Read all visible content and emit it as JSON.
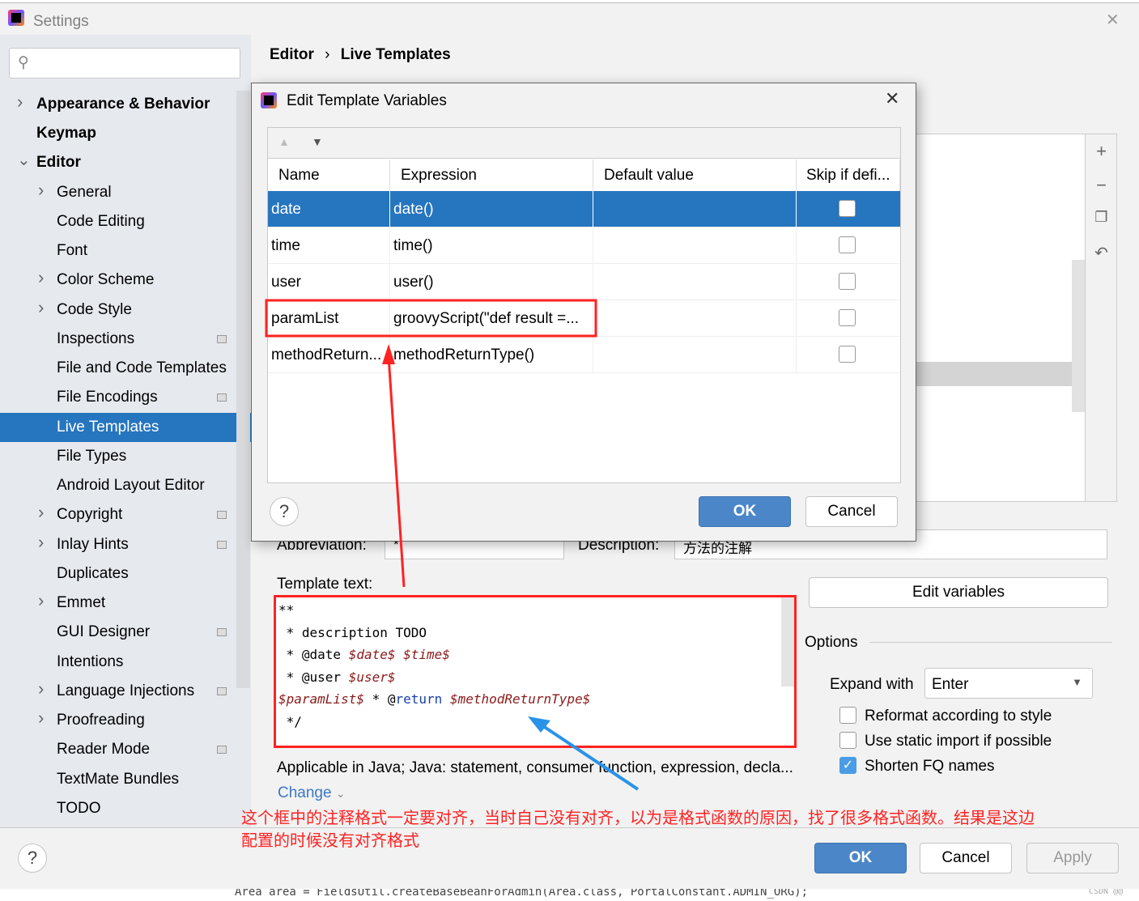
{
  "window": {
    "title": "Settings",
    "close_icon": "close-icon"
  },
  "search": {
    "placeholder": ""
  },
  "sidebar": {
    "items": [
      {
        "label": "Appearance & Behavior",
        "level": 0,
        "bold": true,
        "chevron": "right"
      },
      {
        "label": "Keymap",
        "level": 0,
        "bold": true
      },
      {
        "label": "Editor",
        "level": 0,
        "bold": true,
        "chevron": "down"
      },
      {
        "label": "General",
        "level": 1,
        "chevron": "right"
      },
      {
        "label": "Code Editing",
        "level": 1
      },
      {
        "label": "Font",
        "level": 1
      },
      {
        "label": "Color Scheme",
        "level": 1,
        "chevron": "right"
      },
      {
        "label": "Code Style",
        "level": 1,
        "chevron": "right"
      },
      {
        "label": "Inspections",
        "level": 1,
        "project_icon": true
      },
      {
        "label": "File and Code Templates",
        "level": 1
      },
      {
        "label": "File Encodings",
        "level": 1,
        "project_icon": true
      },
      {
        "label": "Live Templates",
        "level": 1,
        "selected": true
      },
      {
        "label": "File Types",
        "level": 1
      },
      {
        "label": "Android Layout Editor",
        "level": 1
      },
      {
        "label": "Copyright",
        "level": 1,
        "chevron": "right",
        "project_icon": true
      },
      {
        "label": "Inlay Hints",
        "level": 1,
        "chevron": "right",
        "project_icon": true
      },
      {
        "label": "Duplicates",
        "level": 1
      },
      {
        "label": "Emmet",
        "level": 1,
        "chevron": "right"
      },
      {
        "label": "GUI Designer",
        "level": 1,
        "project_icon": true
      },
      {
        "label": "Intentions",
        "level": 1
      },
      {
        "label": "Language Injections",
        "level": 1,
        "chevron": "right",
        "project_icon": true
      },
      {
        "label": "Proofreading",
        "level": 1,
        "chevron": "right"
      },
      {
        "label": "Reader Mode",
        "level": 1,
        "project_icon": true
      },
      {
        "label": "TextMate Bundles",
        "level": 1
      },
      {
        "label": "TODO",
        "level": 1
      }
    ]
  },
  "breadcrumb": {
    "parent": "Editor",
    "separator": "›",
    "current": "Live Templates"
  },
  "form": {
    "abbreviation_label": "Abbreviation:",
    "abbreviation_value": "*",
    "description_label": "Description:",
    "description_value": "方法的注解",
    "template_text_label": "Template text:",
    "template_lines": [
      [
        {
          "t": "**",
          "c": "p"
        }
      ],
      [
        {
          "t": " * description TODO",
          "c": "p"
        }
      ],
      [
        {
          "t": " * @date ",
          "c": "p"
        },
        {
          "t": "$date$",
          "c": "v"
        },
        {
          "t": " ",
          "c": "p"
        },
        {
          "t": "$time$",
          "c": "v"
        }
      ],
      [
        {
          "t": " * @user ",
          "c": "p"
        },
        {
          "t": "$user$",
          "c": "v"
        }
      ],
      [
        {
          "t": "$paramList$",
          "c": "v"
        },
        {
          "t": " * @",
          "c": "p"
        },
        {
          "t": "return",
          "c": "k"
        },
        {
          "t": " ",
          "c": "p"
        },
        {
          "t": "$methodReturnType$",
          "c": "v"
        }
      ],
      [
        {
          "t": " */",
          "c": "p"
        }
      ]
    ],
    "applicable": "Applicable in Java; Java: statement, consumer function, expression, decla...",
    "change_link": "Change",
    "edit_variables": "Edit variables",
    "options_label": "Options",
    "expand_with_label": "Expand with",
    "expand_with_value": "Enter",
    "checkboxes": [
      {
        "label": "Reformat according to style",
        "checked": false
      },
      {
        "label": "Use static import if possible",
        "checked": false
      },
      {
        "label": "Shorten FQ names",
        "checked": true
      }
    ]
  },
  "dialog": {
    "title": "Edit Template Variables",
    "columns": [
      "Name",
      "Expression",
      "Default value",
      "Skip if defi..."
    ],
    "rows": [
      {
        "name": "date",
        "expression": "date()",
        "default": "",
        "skip": false,
        "selected": true
      },
      {
        "name": "time",
        "expression": "time()",
        "default": "",
        "skip": false
      },
      {
        "name": "user",
        "expression": "user()",
        "default": "",
        "skip": false
      },
      {
        "name": "paramList",
        "expression": "groovyScript(\"def result =...",
        "default": "",
        "skip": false
      },
      {
        "name": "methodReturn...",
        "expression": "methodReturnType()",
        "default": "",
        "skip": false
      }
    ],
    "ok": "OK",
    "cancel": "Cancel",
    "help": "?"
  },
  "footer": {
    "help": "?",
    "ok": "OK",
    "cancel": "Cancel",
    "apply": "Apply"
  },
  "annotation": {
    "note": "这个框中的注释格式一定要对齐，当时自己没有对齐，以为是格式函数的原因，找了很多格式函数。结果是这边配置的时候没有对齐格式",
    "color": "#ff2222",
    "arrow_red": "#ff2222",
    "arrow_blue": "#2a93e8"
  },
  "background_code": "Area area = FieldsUtil.createBaseBeanForAdmin(Area.class, PortalConstant.ADMIN_ORG);",
  "watermark": "CSDN @@",
  "colors": {
    "selection": "#2675bf",
    "primary_button": "#4b87c8"
  }
}
